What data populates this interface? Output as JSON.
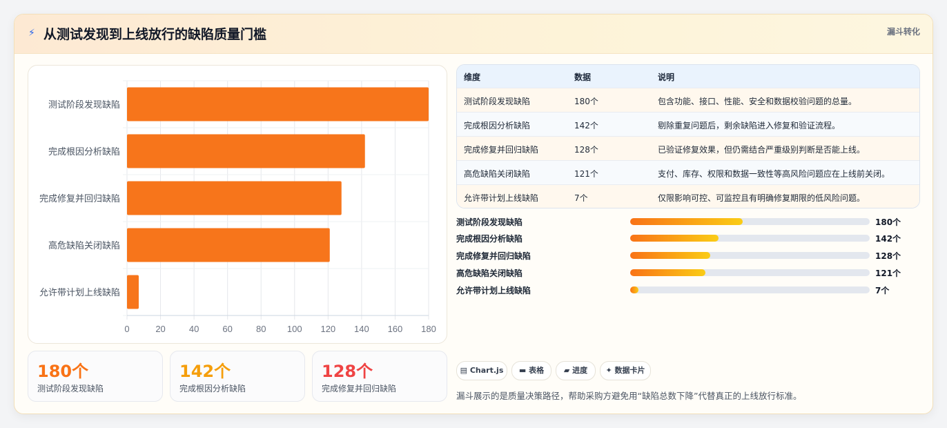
{
  "header": {
    "icon": "bolt-icon",
    "title": "从测试发现到上线放行的缺陷质量门槛",
    "tag": "漏斗转化"
  },
  "chart_data": {
    "type": "bar",
    "orientation": "horizontal",
    "categories": [
      "测试阶段发现缺陷",
      "完成根因分析缺陷",
      "完成修复并回归缺陷",
      "高危缺陷关闭缺陷",
      "允许带计划上线缺陷"
    ],
    "values": [
      180,
      142,
      128,
      121,
      7
    ],
    "xlim": [
      0,
      180
    ],
    "xticks": [
      0,
      20,
      40,
      60,
      80,
      100,
      120,
      140,
      160,
      180
    ],
    "grid": true,
    "color": "#f7751b"
  },
  "kpis": [
    {
      "value": "180个",
      "label": "测试阶段发现缺陷",
      "color": "#f97316"
    },
    {
      "value": "142个",
      "label": "完成根因分析缺陷",
      "color": "#f59e0b"
    },
    {
      "value": "128个",
      "label": "完成修复并回归缺陷",
      "color": "#ef4444"
    }
  ],
  "table": {
    "headers": [
      "维度",
      "数据",
      "说明"
    ],
    "rows": [
      [
        "测试阶段发现缺陷",
        "180个",
        "包含功能、接口、性能、安全和数据校验问题的总量。"
      ],
      [
        "完成根因分析缺陷",
        "142个",
        "剔除重复问题后，剩余缺陷进入修复和验证流程。"
      ],
      [
        "完成修复并回归缺陷",
        "128个",
        "已验证修复效果，但仍需结合严重级别判断是否能上线。"
      ],
      [
        "高危缺陷关闭缺陷",
        "121个",
        "支付、库存、权限和数据一致性等高风险问题应在上线前关闭。"
      ],
      [
        "允许带计划上线缺陷",
        "7个",
        "仅限影响可控、可监控且有明确修复期限的低风险问题。"
      ]
    ]
  },
  "progress": {
    "max": 180,
    "items": [
      {
        "label": "测试阶段发现缺陷",
        "value": 180,
        "text": "180个",
        "fill_fraction": 0.47
      },
      {
        "label": "完成根因分析缺陷",
        "value": 142,
        "text": "142个",
        "fill_fraction": 0.37
      },
      {
        "label": "完成修复并回归缺陷",
        "value": 128,
        "text": "128个",
        "fill_fraction": 0.335
      },
      {
        "label": "高危缺陷关闭缺陷",
        "value": 121,
        "text": "121个",
        "fill_fraction": 0.315
      },
      {
        "label": "允许带计划上线缺陷",
        "value": 7,
        "text": "7个",
        "fill_fraction": 0.035
      }
    ]
  },
  "chips": [
    {
      "icon": "chart-icon",
      "glyph": "▤",
      "label": "Chart.js"
    },
    {
      "icon": "table-icon",
      "glyph": "▬",
      "label": "表格"
    },
    {
      "icon": "progress-icon",
      "glyph": "▰",
      "label": "进度"
    },
    {
      "icon": "sparkle-icon",
      "glyph": "✦",
      "label": "数据卡片"
    }
  ],
  "note": "漏斗展示的是质量决策路径，帮助采购方避免用“缺陷总数下降”代替真正的上线放行标准。"
}
